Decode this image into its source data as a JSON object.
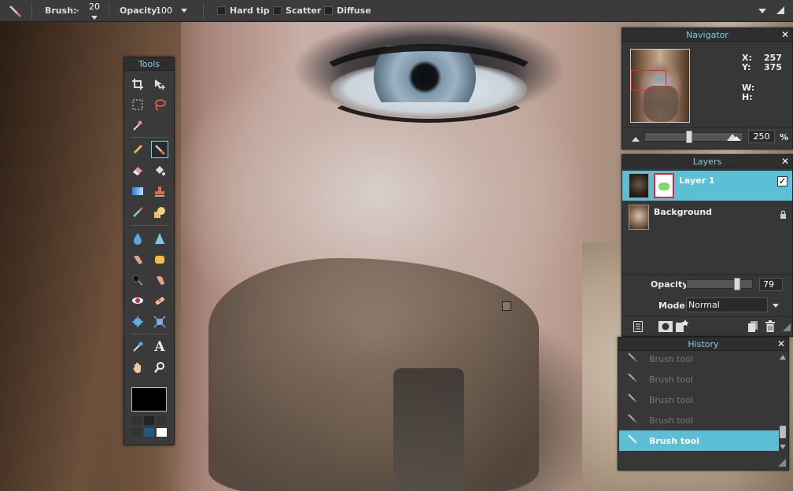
{
  "toolbar": {
    "brush_label": "Brush:",
    "brush_size": "20",
    "opacity_label": "Opacity:",
    "opacity_value": "100",
    "options": [
      {
        "label": "Hard tip",
        "checked": false
      },
      {
        "label": "Scatter",
        "checked": false
      },
      {
        "label": "Diffuse",
        "checked": false
      }
    ]
  },
  "tools": {
    "title": "Tools",
    "active": "brush",
    "primary_color": "#000000"
  },
  "navigator": {
    "title": "Navigator",
    "x_label": "X:",
    "x_value": "257",
    "y_label": "Y:",
    "y_value": "375",
    "w_label": "W:",
    "w_value": "",
    "h_label": "H:",
    "h_value": "",
    "zoom": "250",
    "zoom_unit": "%",
    "zoom_fraction": 0.45
  },
  "layers": {
    "title": "Layers",
    "items": [
      {
        "name": "Layer 1",
        "visible": true,
        "selected": true
      },
      {
        "name": "Background",
        "locked": true,
        "selected": false
      }
    ],
    "opacity_label": "Opacity:",
    "opacity_value": "79",
    "opacity_fraction": 0.79,
    "mode_label": "Mode:",
    "mode_value": "Normal"
  },
  "history": {
    "title": "History",
    "items": [
      {
        "label": "Brush tool",
        "active": false
      },
      {
        "label": "Brush tool",
        "active": false
      },
      {
        "label": "Brush tool",
        "active": false
      },
      {
        "label": "Brush tool",
        "active": false
      },
      {
        "label": "Brush tool",
        "active": true
      }
    ]
  },
  "colors": {
    "accent": "#5bbfd6",
    "panel_bg": "#373737"
  }
}
